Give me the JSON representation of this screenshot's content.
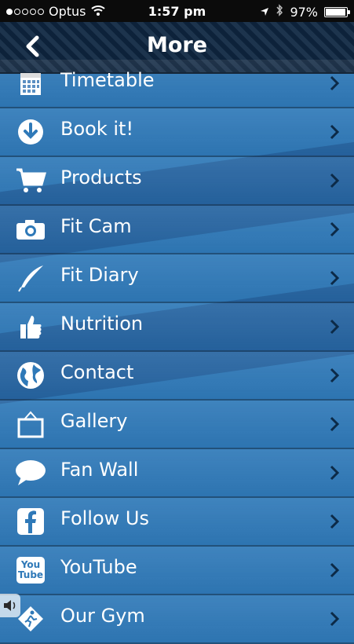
{
  "status": {
    "carrier": "Optus",
    "time": "1:57 pm",
    "battery": "97%",
    "signal_dots_filled": 1,
    "signal_dots_total": 5
  },
  "navbar": {
    "title": "More",
    "back_icon": "chevron-left-icon"
  },
  "colors": {
    "list_bg": "#2f79b8",
    "navbar_bg": "#0f2742",
    "status_bg": "#0b0b0b",
    "text": "#ffffff"
  },
  "menu": [
    {
      "label": "Timetable",
      "icon": "calendar-icon"
    },
    {
      "label": "Book it!",
      "icon": "download-icon"
    },
    {
      "label": "Products",
      "icon": "cart-icon"
    },
    {
      "label": "Fit Cam",
      "icon": "camera-icon"
    },
    {
      "label": "Fit Diary",
      "icon": "quill-icon"
    },
    {
      "label": "Nutrition",
      "icon": "thumbs-up-icon"
    },
    {
      "label": "Contact",
      "icon": "globe-icon"
    },
    {
      "label": "Gallery",
      "icon": "picture-frame-icon"
    },
    {
      "label": "Fan Wall",
      "icon": "speech-bubble-icon"
    },
    {
      "label": "Follow Us",
      "icon": "facebook-icon"
    },
    {
      "label": "YouTube",
      "icon": "youtube-icon",
      "icon_text": "You Tube"
    },
    {
      "label": "Our Gym",
      "icon": "runner-icon"
    }
  ]
}
